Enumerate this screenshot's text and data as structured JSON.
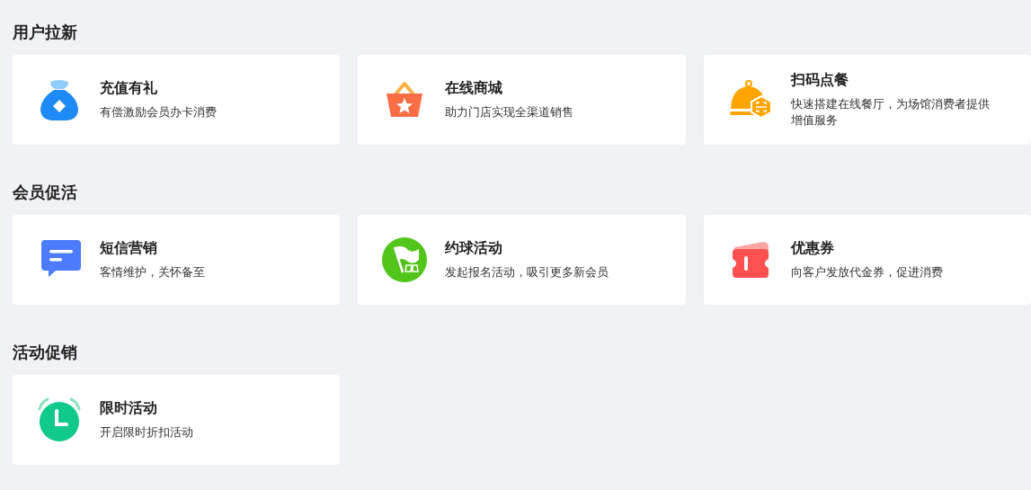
{
  "sections": [
    {
      "title": "用户拉新",
      "items": [
        {
          "kind": "bag",
          "title": "充值有礼",
          "description": "有偿激励会员办卡消费"
        },
        {
          "kind": "basket",
          "title": "在线商城",
          "description": "助力门店实现全渠道销售"
        },
        {
          "kind": "cloche",
          "title": "扫码点餐",
          "description": "快速搭建在线餐厅，为场馆消费者提供增值服务"
        }
      ]
    },
    {
      "title": "会员促活",
      "items": [
        {
          "kind": "message",
          "title": "短信营销",
          "description": "客情维护，关怀备至"
        },
        {
          "kind": "flag",
          "title": "约球活动",
          "description": "发起报名活动，吸引更多新会员"
        },
        {
          "kind": "ticket",
          "title": "优惠券",
          "description": "向客户发放代金券，促进消费"
        }
      ]
    },
    {
      "title": "活动促销",
      "items": [
        {
          "kind": "alarm",
          "title": "限时活动",
          "description": "开启限时折扣活动"
        }
      ]
    }
  ]
}
